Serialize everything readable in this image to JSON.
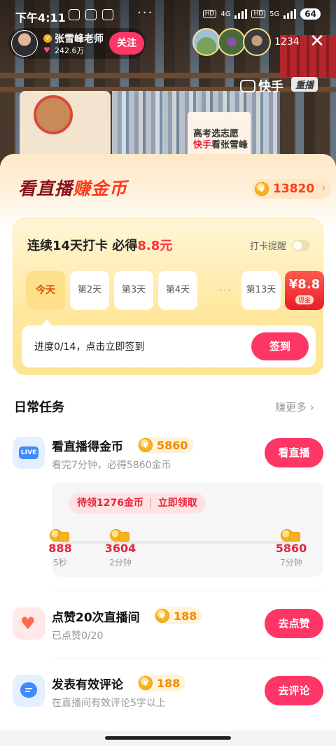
{
  "status_bar": {
    "time": "下午4:11",
    "battery": "64",
    "net_4g": "4G",
    "net_5g": "5G",
    "hd1": "HD",
    "hd2": "HD"
  },
  "streamer": {
    "name": "张雪峰老师",
    "fans": "242.6万",
    "follow_label": "关注",
    "viewer_count": "1234"
  },
  "live_scene": {
    "brand": "快手",
    "replay_tag": "重播",
    "standee_line1": "高考选志愿",
    "standee_line2_red": "快手",
    "standee_line2": "看张雪峰"
  },
  "panel": {
    "title_dark": "看直播",
    "title_hot": "赚金币",
    "coin_balance": "13820",
    "coin_symbol": "¥"
  },
  "checkin": {
    "title_prefix": "连续14天打卡 必得",
    "title_amount": "8.8元",
    "reminder_label": "打卡提醒",
    "reminder_on": false,
    "days": [
      "今天",
      "第2天",
      "第3天",
      "第4天",
      "第13天"
    ],
    "ellipsis": "···",
    "final_reward_value": "¥8.8",
    "final_reward_tag": "现金",
    "progress_text": "进度0/14，点击立即签到",
    "sign_label": "签到"
  },
  "daily": {
    "title": "日常任务",
    "more_label": "赚更多 ›",
    "tasks": [
      {
        "icon": "live-icon",
        "icon_text": "LIVE",
        "name": "看直播得金币",
        "reward": "5860",
        "desc": "看完7分钟，必得5860金币",
        "button": "看直播"
      },
      {
        "icon": "heart-icon",
        "name": "点赞20次直播间",
        "reward": "188",
        "desc": "已点赞0/20",
        "button": "去点赞"
      },
      {
        "icon": "comment-icon",
        "name": "发表有效评论",
        "reward": "188",
        "desc": "在直播间有效评论5字以上",
        "button": "去评论"
      }
    ],
    "watch_track": {
      "claim_text": "待领1276金币",
      "claim_action": "立即领取",
      "milestones": [
        {
          "value": "888",
          "time": "5秒"
        },
        {
          "value": "3604",
          "time": "2分钟"
        },
        {
          "value": "5860",
          "time": "7分钟"
        }
      ]
    }
  }
}
